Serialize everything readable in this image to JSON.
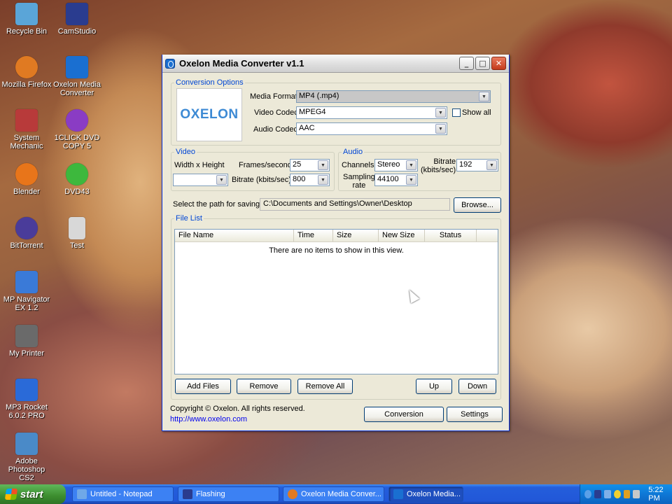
{
  "desktop": {
    "icons": [
      {
        "label": "Recycle Bin",
        "color": "#5aa5d8"
      },
      {
        "label": "CamStudio",
        "color": "#2a3c8f"
      },
      {
        "label": "Mozilla Firefox",
        "color": "#e07a22"
      },
      {
        "label": "Oxelon Media Converter",
        "color": "#1a6fd1"
      },
      {
        "label": "System Mechanic",
        "color": "#b83a3a"
      },
      {
        "label": "1CLICK DVD COPY 5",
        "color": "#8a3cc4"
      },
      {
        "label": "Blender",
        "color": "#e8751a"
      },
      {
        "label": "DVD43",
        "color": "#3db83d"
      },
      {
        "label": "BitTorrent",
        "color": "#4a3c9a"
      },
      {
        "label": "Test",
        "color": "#d8d8d8"
      },
      {
        "label": "MP Navigator EX 1.2",
        "color": "#3a7ad8"
      },
      {
        "label": "My Printer",
        "color": "#6a6a6a"
      },
      {
        "label": "MP3 Rocket 6.0.2 PRO",
        "color": "#2a6ad8"
      },
      {
        "label": "Adobe Photoshop CS2",
        "color": "#4a8ac8"
      }
    ]
  },
  "window": {
    "title": "Oxelon Media Converter v1.1",
    "minimize": "_",
    "maximize": "□",
    "close": "✕"
  },
  "conversion": {
    "legend": "Conversion Options",
    "logo_text": "OXELON",
    "media_format_label": "Media Format",
    "media_format_value": "MP4 (.mp4)",
    "video_codec_label": "Video Codec",
    "video_codec_value": "MPEG4",
    "show_all_label": "Show all",
    "audio_codec_label": "Audio Codec",
    "audio_codec_value": "AAC"
  },
  "video": {
    "legend": "Video",
    "size_label": "Width x Height",
    "size_value": "",
    "fps_label": "Frames/second",
    "fps_value": "25",
    "bitrate_label": "Bitrate (kbits/sec)",
    "bitrate_value": "800"
  },
  "audio": {
    "legend": "Audio",
    "channels_label": "Channels",
    "channels_value": "Stereo",
    "bitrate_label_line1": "Bitrate",
    "bitrate_label_line2": "(kbits/sec)",
    "bitrate_value": "192",
    "sampling_label_line1": "Sampling",
    "sampling_label_line2": "rate",
    "sampling_value": "44100"
  },
  "path": {
    "label": "Select the path for saving:",
    "value": "C:\\Documents and Settings\\Owner\\Desktop",
    "browse": "Browse..."
  },
  "file_list": {
    "legend": "File List",
    "columns": [
      "File Name",
      "Time",
      "Size",
      "New Size",
      "Status"
    ],
    "empty_text": "There are no items to show in this view.",
    "add_files": "Add Files",
    "remove": "Remove",
    "remove_all": "Remove All",
    "up": "Up",
    "down": "Down"
  },
  "footer": {
    "copyright": "Copyright © Oxelon. All rights reserved.",
    "url": "http://www.oxelon.com",
    "conversion": "Conversion",
    "settings": "Settings"
  },
  "taskbar": {
    "start": "start",
    "tasks": [
      {
        "label": "Untitled - Notepad",
        "color": "#6fa8e8"
      },
      {
        "label": "Flashing",
        "color": "#2a3c8f"
      },
      {
        "label": "Oxelon Media Conver...",
        "color": "#e07a22"
      },
      {
        "label": "Oxelon Media...",
        "color": "#1a6fd1"
      }
    ],
    "clock": "5:22 PM"
  }
}
